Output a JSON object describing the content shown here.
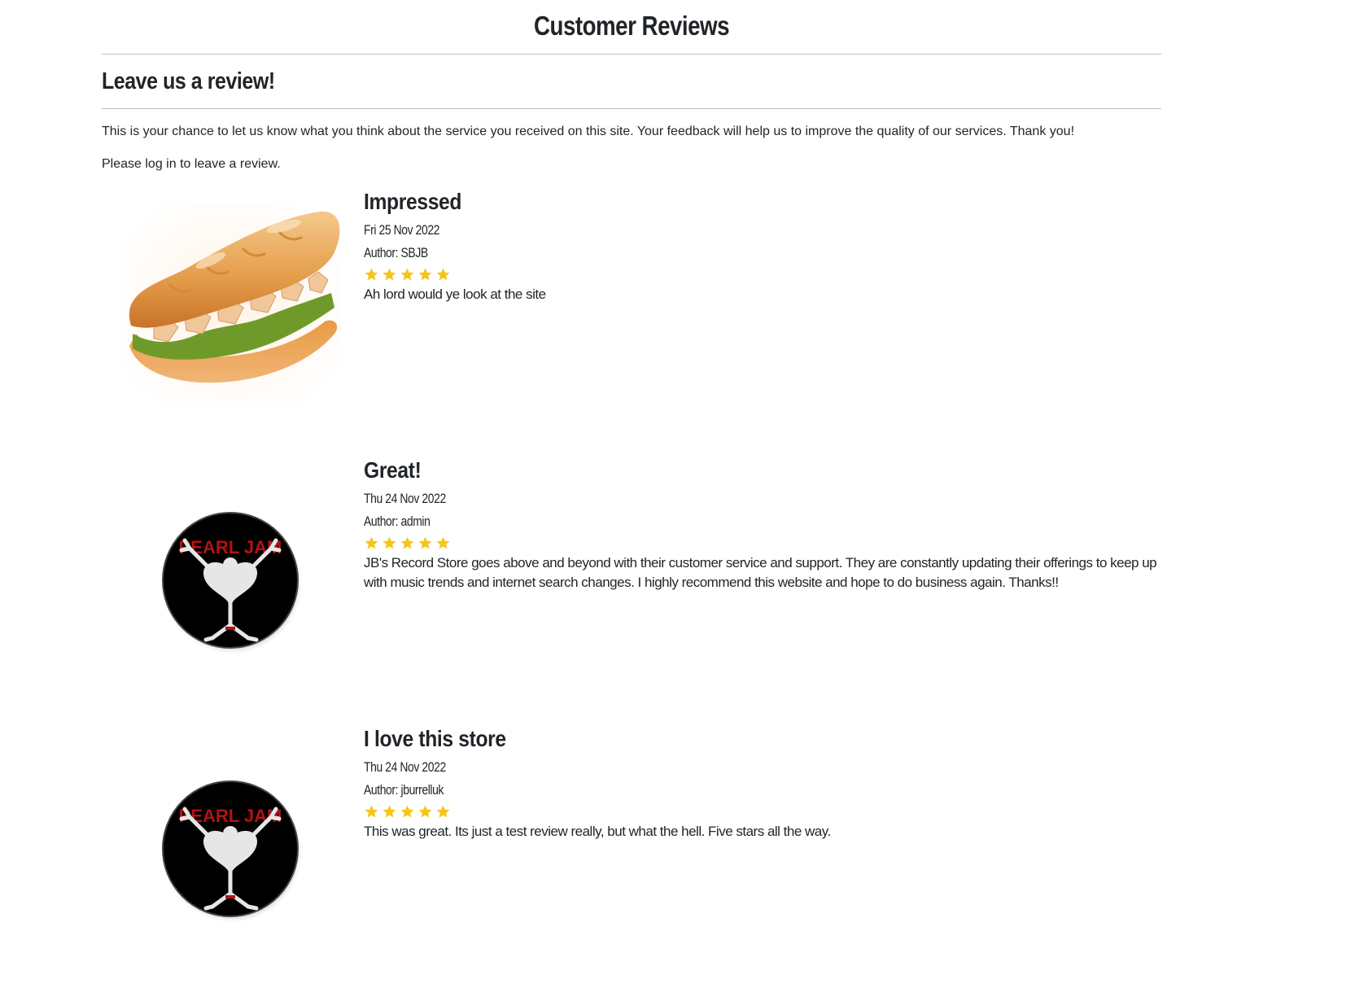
{
  "page": {
    "title": "Customer Reviews"
  },
  "leave_review": {
    "heading": "Leave us a review!",
    "intro": "This is your chance to let us know what you think about the service you received on this site. Your feedback will help us to improve the quality of our services. Thank you!",
    "login_prompt": "Please log in to leave a review."
  },
  "colors": {
    "star": "#f5c518",
    "text": "#212529",
    "divider": "#bfbfbf"
  },
  "reviews": [
    {
      "title": "Impressed",
      "date": "Fri 25 Nov 2022",
      "author": "Author: SBJB",
      "rating": 5,
      "body": "Ah lord would ye look at the site",
      "image": "sandwich-image"
    },
    {
      "title": "Great!",
      "date": "Thu 24 Nov 2022",
      "author": "Author: admin",
      "rating": 5,
      "body": "JB's Record Store goes above and beyond with their customer service and support. They are constantly updating their offerings to keep up with music trends and internet search changes. I highly recommend this website and hope to do business again. Thanks!!",
      "image": "pearl-jam-badge-image"
    },
    {
      "title": "I love this store",
      "date": "Thu 24 Nov 2022",
      "author": "Author: jburrelluk",
      "rating": 5,
      "body": "This was great. Its just a test review really, but what the hell. Five stars all the way.",
      "image": "pearl-jam-badge-image"
    }
  ],
  "badge_text": "PEARL JAM"
}
